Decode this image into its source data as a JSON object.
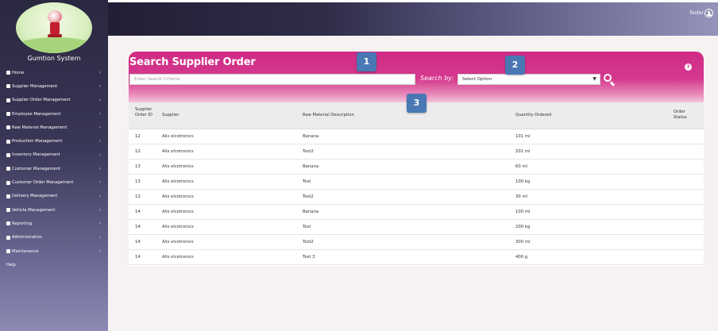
{
  "sidebar": {
    "system_name": "Gumtion System",
    "items": [
      {
        "label": "Home",
        "icon": "home-icon",
        "chevron": "‹"
      },
      {
        "label": "Supplier Management",
        "icon": "users-icon",
        "chevron": "‹"
      },
      {
        "label": "Supplier Order Management",
        "icon": "cart-icon",
        "chevron": "‹"
      },
      {
        "label": "Employee Management",
        "icon": "id-card-icon",
        "chevron": "‹"
      },
      {
        "label": "Raw Material Management",
        "icon": "truck-icon",
        "chevron": "‹"
      },
      {
        "label": "Production Management",
        "icon": "cogs-icon",
        "chevron": "‹"
      },
      {
        "label": "Inventory Management",
        "icon": "list-icon",
        "chevron": "‹"
      },
      {
        "label": "Customer Management",
        "icon": "address-card-icon",
        "chevron": "‹"
      },
      {
        "label": "Customer Order Management",
        "icon": "file-icon",
        "chevron": "‹"
      },
      {
        "label": "Delivery Management",
        "icon": "delivery-truck-icon",
        "chevron": "‹"
      },
      {
        "label": "Vehicle Management",
        "icon": "car-icon",
        "chevron": "‹"
      },
      {
        "label": "Reporting",
        "icon": "chart-icon",
        "chevron": "‹"
      },
      {
        "label": "Administration",
        "icon": "laptop-icon",
        "chevron": "‹"
      },
      {
        "label": "Maintanence",
        "icon": "gear-icon",
        "chevron": "‹"
      },
      {
        "label": "Help",
        "icon": "",
        "chevron": ""
      }
    ]
  },
  "topbar": {
    "user_name": "Tester"
  },
  "panel": {
    "title": "Search Supplier Order",
    "search_placeholder": "Enter Search Criteria",
    "search_by_label": "Search by:",
    "select_value": "Select Option",
    "select_arrow": "▼",
    "help_label": "?"
  },
  "badges": [
    "1",
    "2",
    "3"
  ],
  "table": {
    "headers": [
      "Supplier Order ID",
      "Supplier",
      "Raw Material Description",
      "Quantity Ordered",
      "Order Status"
    ],
    "rows": [
      [
        "12",
        "Alis elcetronics",
        "Banana",
        "101 ml",
        ""
      ],
      [
        "12",
        "Alis elcetronics",
        "Test2",
        "201 ml",
        ""
      ],
      [
        "13",
        "Alis elcetronics",
        "Banana",
        "60 ml",
        ""
      ],
      [
        "13",
        "Alis elcetronics",
        "Test",
        "100 kg",
        ""
      ],
      [
        "13",
        "Alis elcetronics",
        "Test2",
        "30 ml",
        ""
      ],
      [
        "14",
        "Alis elcetronics",
        "Banana",
        "100 ml",
        ""
      ],
      [
        "14",
        "Alis elcetronics",
        "Test",
        "200 kg",
        ""
      ],
      [
        "14",
        "Alis elcetronics",
        "Test2",
        "300 ml",
        ""
      ],
      [
        "14",
        "Alis elcetronics",
        "Test 3",
        "400 g",
        ""
      ]
    ]
  },
  "colors": {
    "accent": "#cf2a85",
    "badge": "#4978b4",
    "sidebar_top": "#2a2740",
    "sidebar_bottom": "#8d8ab3"
  }
}
